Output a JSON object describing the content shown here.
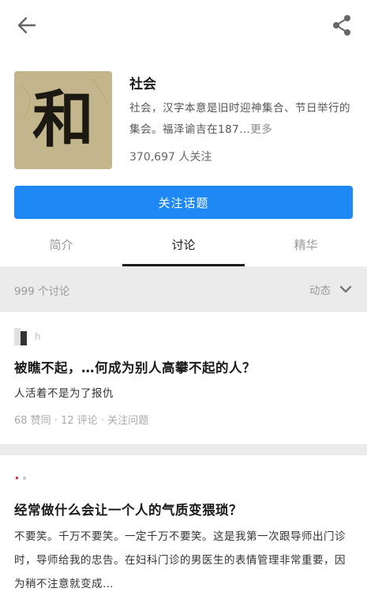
{
  "header": {
    "back_icon": "arrow-left-icon",
    "share_icon": "share-icon"
  },
  "topic": {
    "cover_char": "和",
    "title": "社会",
    "description": "社会，汉字本意是旧时迎神集合、节日举行的集会。福泽谕吉在187…",
    "more_label": "更多",
    "follow_count": "370,697 人关注"
  },
  "follow_button": {
    "label": "关注话题",
    "color": "#1e88f5"
  },
  "tabs": [
    {
      "label": "简介",
      "active": false
    },
    {
      "label": "讨论",
      "active": true
    },
    {
      "label": "精华",
      "active": false
    }
  ],
  "discussion_bar": {
    "count_label": "999 个讨论",
    "sort_label": "动态",
    "sort_icon": "chevron-down-icon"
  },
  "posts": [
    {
      "user_name": "h",
      "title": "被瞧不起，…何成为别人高攀不起的人？",
      "excerpt": "人活着不是为了报仇",
      "meta": "68 赞同 · 12 评论 · 关注问题"
    },
    {
      "user_name": "",
      "title": "经常做什么会让一个人的气质变猥琐？",
      "excerpt": "不要笑。千万不要笑。一定千万不要笑。这是我第一次跟导师出门诊时，导师给我的忠告。在妇科门诊的男医生的表情管理非常重要，因为稍不注意就变成…"
    }
  ]
}
